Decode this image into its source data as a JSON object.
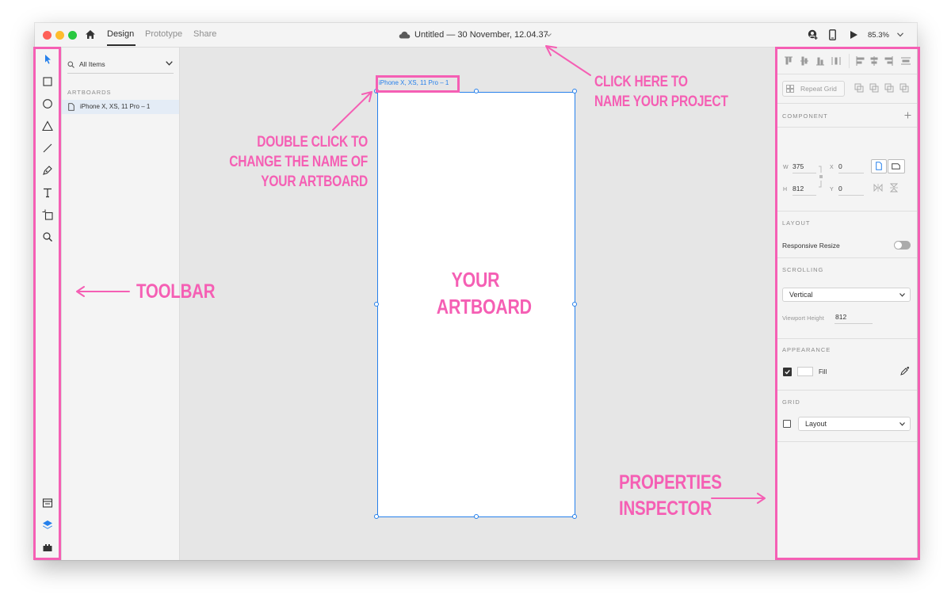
{
  "titlebar": {
    "tabs": [
      "Design",
      "Prototype",
      "Share"
    ],
    "active_tab": "Design",
    "document_title": "Untitled — 30 November, 12.04.37",
    "zoom": "85.3%",
    "traffic_light_colors": [
      "#fe5f57",
      "#febc2e",
      "#28c840"
    ]
  },
  "toolbar": {
    "tools": [
      "select-icon",
      "rectangle-icon",
      "ellipse-icon",
      "triangle-icon",
      "line-icon",
      "pen-icon",
      "text-icon",
      "artboard-icon",
      "zoom-icon"
    ],
    "bottom": [
      "document-assets-icon",
      "layers-icon",
      "plugins-icon"
    ]
  },
  "layers": {
    "filter_value": "All Items",
    "section_label": "ARTBOARDS",
    "artboards": [
      "iPhone X, XS, 11 Pro – 1"
    ]
  },
  "canvas": {
    "artboard_name": "iPhone X, XS, 11 Pro – 1",
    "background": "#e6e6e6"
  },
  "inspector": {
    "repeat_grid_label": "Repeat Grid",
    "component_label": "COMPONENT",
    "w_label": "W",
    "w_value": "375",
    "h_label": "H",
    "h_value": "812",
    "x_label": "X",
    "x_value": "0",
    "y_label": "Y",
    "y_value": "0",
    "layout_label": "LAYOUT",
    "responsive_resize_label": "Responsive Resize",
    "scrolling_label": "SCROLLING",
    "scrolling_value": "Vertical",
    "viewport_height_label": "Viewport Height",
    "viewport_height_value": "812",
    "appearance_label": "APPEARANCE",
    "fill_label": "Fill",
    "grid_label": "GRID",
    "grid_value": "Layout"
  },
  "annotations": {
    "color": "#f55fb4",
    "name_project": [
      "CLICK HERE TO",
      "NAME YOUR PROJECT"
    ],
    "rename_artboard": [
      "DOUBLE CLICK TO",
      "CHANGE THE NAME OF",
      "YOUR ARTBOARD"
    ],
    "artboard": [
      "YOUR",
      "ARTBOARD"
    ],
    "toolbar": "TOOLBAR",
    "inspector": [
      "PROPERTIES",
      "INSPECTOR"
    ]
  }
}
